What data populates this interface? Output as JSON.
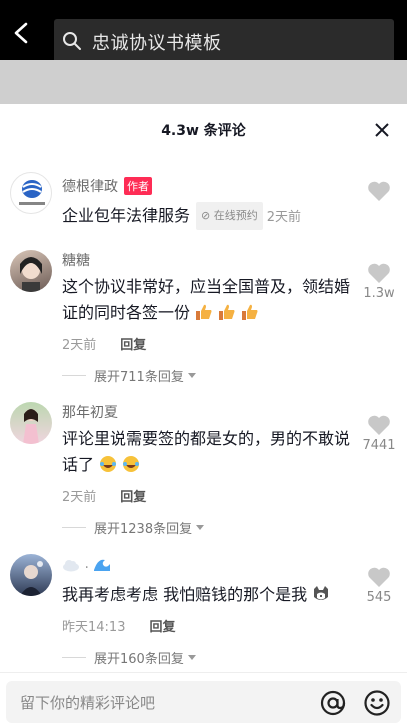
{
  "search": {
    "query": "忠诚协议书模板"
  },
  "sheet": {
    "title": "4.3w 条评论"
  },
  "comments": [
    {
      "user": "德根律政",
      "author_badge": "作者",
      "avatar_caption": "德根律政",
      "text": "企业包年法律服务",
      "service_tag": "在线预约",
      "time": "2天前"
    },
    {
      "user": "糖糖",
      "text": "这个协议非常好，应当全国普及，领结婚证的同时各签一份",
      "time": "2天前",
      "reply": "回复",
      "expand": "展开711条回复",
      "likes": "1.3w"
    },
    {
      "user": "那年初夏",
      "text": "评论里说需要签的都是女的，男的不敢说话了",
      "time": "2天前",
      "reply": "回复",
      "expand": "展开1238条回复",
      "likes": "7441"
    },
    {
      "user": "",
      "text": "我再考虑考虑 我怕赔钱的那个是我",
      "time": "昨天14:13",
      "reply": "回复",
      "expand": "展开160条回复",
      "likes": "545"
    }
  ],
  "input": {
    "placeholder": "留下你的精彩评论吧"
  },
  "colors": {
    "accent": "#fe2c55",
    "topbar": "#000000"
  }
}
